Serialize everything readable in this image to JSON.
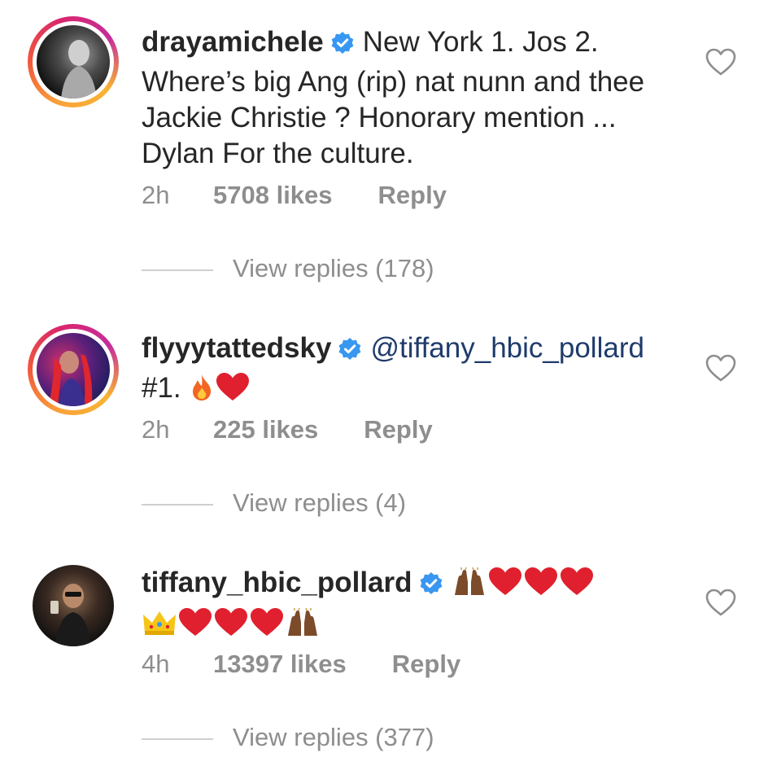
{
  "comments": [
    {
      "username": "drayamichele",
      "text_line1": "New York 1.  Jos 2.",
      "text_rest": "Where’s big Ang (rip) nat nunn and thee Jackie Christie ? Honorary mention ... Dylan For the culture.",
      "time": "2h",
      "likes": "5708 likes",
      "reply": "Reply",
      "view_replies": "View replies (178)",
      "avatar_style": "story-ring"
    },
    {
      "username": "flyyytattedsky",
      "mention": "@tiffany_hbic_pollard",
      "text": "#1.",
      "emojis": [
        "fire-emoji",
        "red-heart-emoji"
      ],
      "time": "2h",
      "likes": "225 likes",
      "reply": "Reply",
      "view_replies": "View replies (4)",
      "avatar_style": "story-ring"
    },
    {
      "username": "tiffany_hbic_pollard",
      "emojis_line1": [
        "raising-hands-emoji",
        "red-heart-emoji",
        "red-heart-emoji",
        "red-heart-emoji"
      ],
      "emojis_line2": [
        "crown-emoji",
        "red-heart-emoji",
        "red-heart-emoji",
        "red-heart-emoji",
        "raising-hands-emoji"
      ],
      "time": "4h",
      "likes": "13397 likes",
      "reply": "Reply",
      "view_replies": "View replies (377)",
      "avatar_style": "plain"
    }
  ],
  "colors": {
    "text": "#262626",
    "meta": "#8e8e8e",
    "mention": "#1f3b6b",
    "verified": "#3897f0",
    "heart_outline": "#8e8e8e"
  },
  "icons": [
    "verified-badge-icon",
    "like-heart-icon"
  ]
}
